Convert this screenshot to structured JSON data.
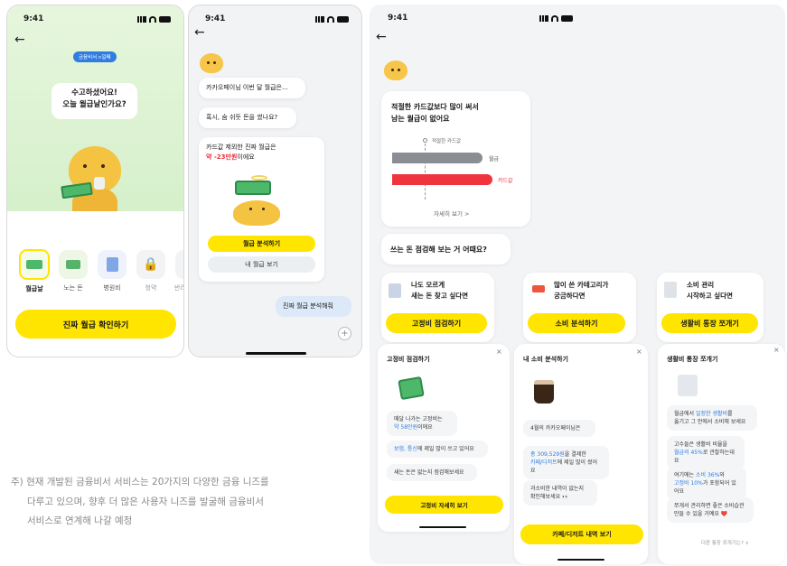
{
  "status_time": "9:41",
  "phone1": {
    "badge": "금융비서 n일째",
    "speech": [
      "수고하셨어요!",
      "오늘 월급날인가요?"
    ],
    "categories": [
      {
        "label": "월급날",
        "selected": true
      },
      {
        "label": "노는 돈",
        "selected": false
      },
      {
        "label": "병원비",
        "selected": false
      },
      {
        "label": "청약",
        "selected": false
      },
      {
        "label": "반려동",
        "selected": false
      }
    ],
    "cta": "진짜 월급 확인하기"
  },
  "phone2": {
    "msg1": "카카오페이님 이번 달 월급은...",
    "msg2": "혹시, 숨 쉬듯 돈을 썼나요?",
    "msg3_line1": "카드값 제외한 진짜 월급은",
    "msg3_amount": "약 -23만원",
    "msg3_suffix": "이에요",
    "btn_analyze": "월급 분석하기",
    "btn_view": "내 월급 보기",
    "user_reply": "진짜 월급 분석해줘",
    "plus": "+"
  },
  "panel": {
    "card1_title": [
      "적절한 카드값보다 많이 써서",
      "남는 월급이 없어요"
    ],
    "marker_label": "적절한 카드값",
    "bar1_label": "월급",
    "bar2_label": "카드값",
    "detail_link": "자세히 보기 >",
    "question": "쓰는 돈 점검해 보는 거 어때요?",
    "options": [
      {
        "title": [
          "나도 모르게",
          "새는 돈 찾고 싶다면"
        ],
        "button": "고정비 점검하기"
      },
      {
        "title": [
          "많이 쓴 카테고리가",
          "궁금하다면"
        ],
        "button": "소비 분석하기"
      },
      {
        "title": [
          "소비 관리",
          "시작하고 싶다면"
        ],
        "button": "생활비 통장 쪼개기"
      }
    ],
    "sheets": [
      {
        "title": "고정비 점검하기",
        "close": "×",
        "items": [
          {
            "parts": [
              [
                "매달 나가는 고정비는",
                ""
              ],
              [
                "약 58만원",
                "blue"
              ],
              [
                "이에요",
                ""
              ]
            ]
          },
          {
            "parts": [
              [
                "보험, 통신",
                "blue"
              ],
              [
                "에 제일 많이 쓰고 있어요",
                ""
              ]
            ]
          },
          {
            "parts": [
              [
                "새는 돈은 없는지 점검해보세요",
                ""
              ]
            ]
          }
        ],
        "button": "고정비 자세히 보기"
      },
      {
        "title": "내 소비 분석하기",
        "close": "×",
        "items": [
          {
            "parts": [
              [
                "4월의 카카오페이님은",
                ""
              ]
            ]
          },
          {
            "parts": [
              [
                "총 309,529원",
                "blue"
              ],
              [
                "을 결제한",
                ""
              ],
              [
                "카페/디저트",
                "blue"
              ],
              [
                "에 제일 많이 썼어요",
                ""
              ]
            ]
          },
          {
            "parts": [
              [
                "과소비한 내역이 없는지",
                ""
              ],
              [
                "확인해보세요 👀",
                ""
              ]
            ]
          }
        ],
        "button": "카페/디저트 내역 보기"
      },
      {
        "title": "생활비 통장 쪼개기",
        "close": "×",
        "items": [
          {
            "parts": [
              [
                "월급에서 ",
                ""
              ],
              [
                "일정한 생활비",
                "blue"
              ],
              [
                "를",
                ""
              ],
              [
                "옮기고 그 안에서 소비해 보세요",
                ""
              ]
            ]
          },
          {
            "parts": [
              [
                "고수들은 생활비 비율을",
                ""
              ],
              [
                "월급의 45%",
                "blue"
              ],
              [
                "로 관찰하는대요",
                ""
              ]
            ]
          },
          {
            "parts": [
              [
                "여기에는 ",
                ""
              ],
              [
                "소비 36%",
                "blue"
              ],
              [
                "와",
                ""
              ],
              [
                "고정비 10%",
                "blue"
              ],
              [
                "가 포함되어 있어요",
                ""
              ]
            ]
          },
          {
            "parts": [
              [
                "쪼개서 관리하면 좋은 소비습관",
                ""
              ],
              [
                "만들 수 있을 거예요 ❤️",
                ""
              ]
            ]
          }
        ],
        "link": "다른 통장 쪼개기는? ∨"
      }
    ]
  },
  "footnote": {
    "prefix": "주)",
    "lines": [
      "현재 개발된 금융비서 서비스는 20가지의 다양한 금융 니즈를",
      "다루고 있으며, 향후 더 많은 사용자 니즈를 발굴해 금융비서",
      "서비스로 연계해 나갈 예정"
    ]
  },
  "colors": {
    "accent": "#ffe500",
    "blue": "#2f7de1",
    "red": "#e8313b",
    "panel_bg": "#f3f4f6"
  }
}
